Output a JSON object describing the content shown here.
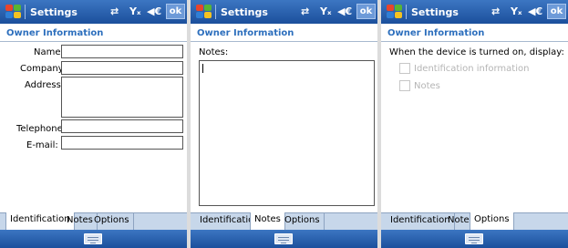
{
  "titlebar": {
    "title": "Settings",
    "ok_label": "ok",
    "sync_glyph": "⇄",
    "signal_glyph": "Yₓ",
    "speaker_glyph": "◀€"
  },
  "header": "Owner Information",
  "tabs": [
    "Identification",
    "Notes",
    "Options"
  ],
  "identification": {
    "name_label": "Name:",
    "company_label": "Company:",
    "address_label": "Address:",
    "telephone_label": "Telephone:",
    "email_label": "E-mail:",
    "name_value": "",
    "company_value": "",
    "address_value": "",
    "telephone_value": "",
    "email_value": ""
  },
  "notes": {
    "label": "Notes:",
    "value": ""
  },
  "options": {
    "prompt": "When the device is turned on, display:",
    "checkboxes": [
      {
        "label": "Identification information",
        "checked": false
      },
      {
        "label": "Notes",
        "checked": false
      }
    ]
  },
  "icons": {
    "start": "windows-start-icon",
    "sync": "sync-icon",
    "signal": "signal-off-icon",
    "speaker": "speaker-icon",
    "keyboard": "keyboard-icon"
  },
  "colors": {
    "titlebar": "#1b4f9c",
    "header_text": "#2d6fbd",
    "tabbar": "#c7d7ea"
  }
}
